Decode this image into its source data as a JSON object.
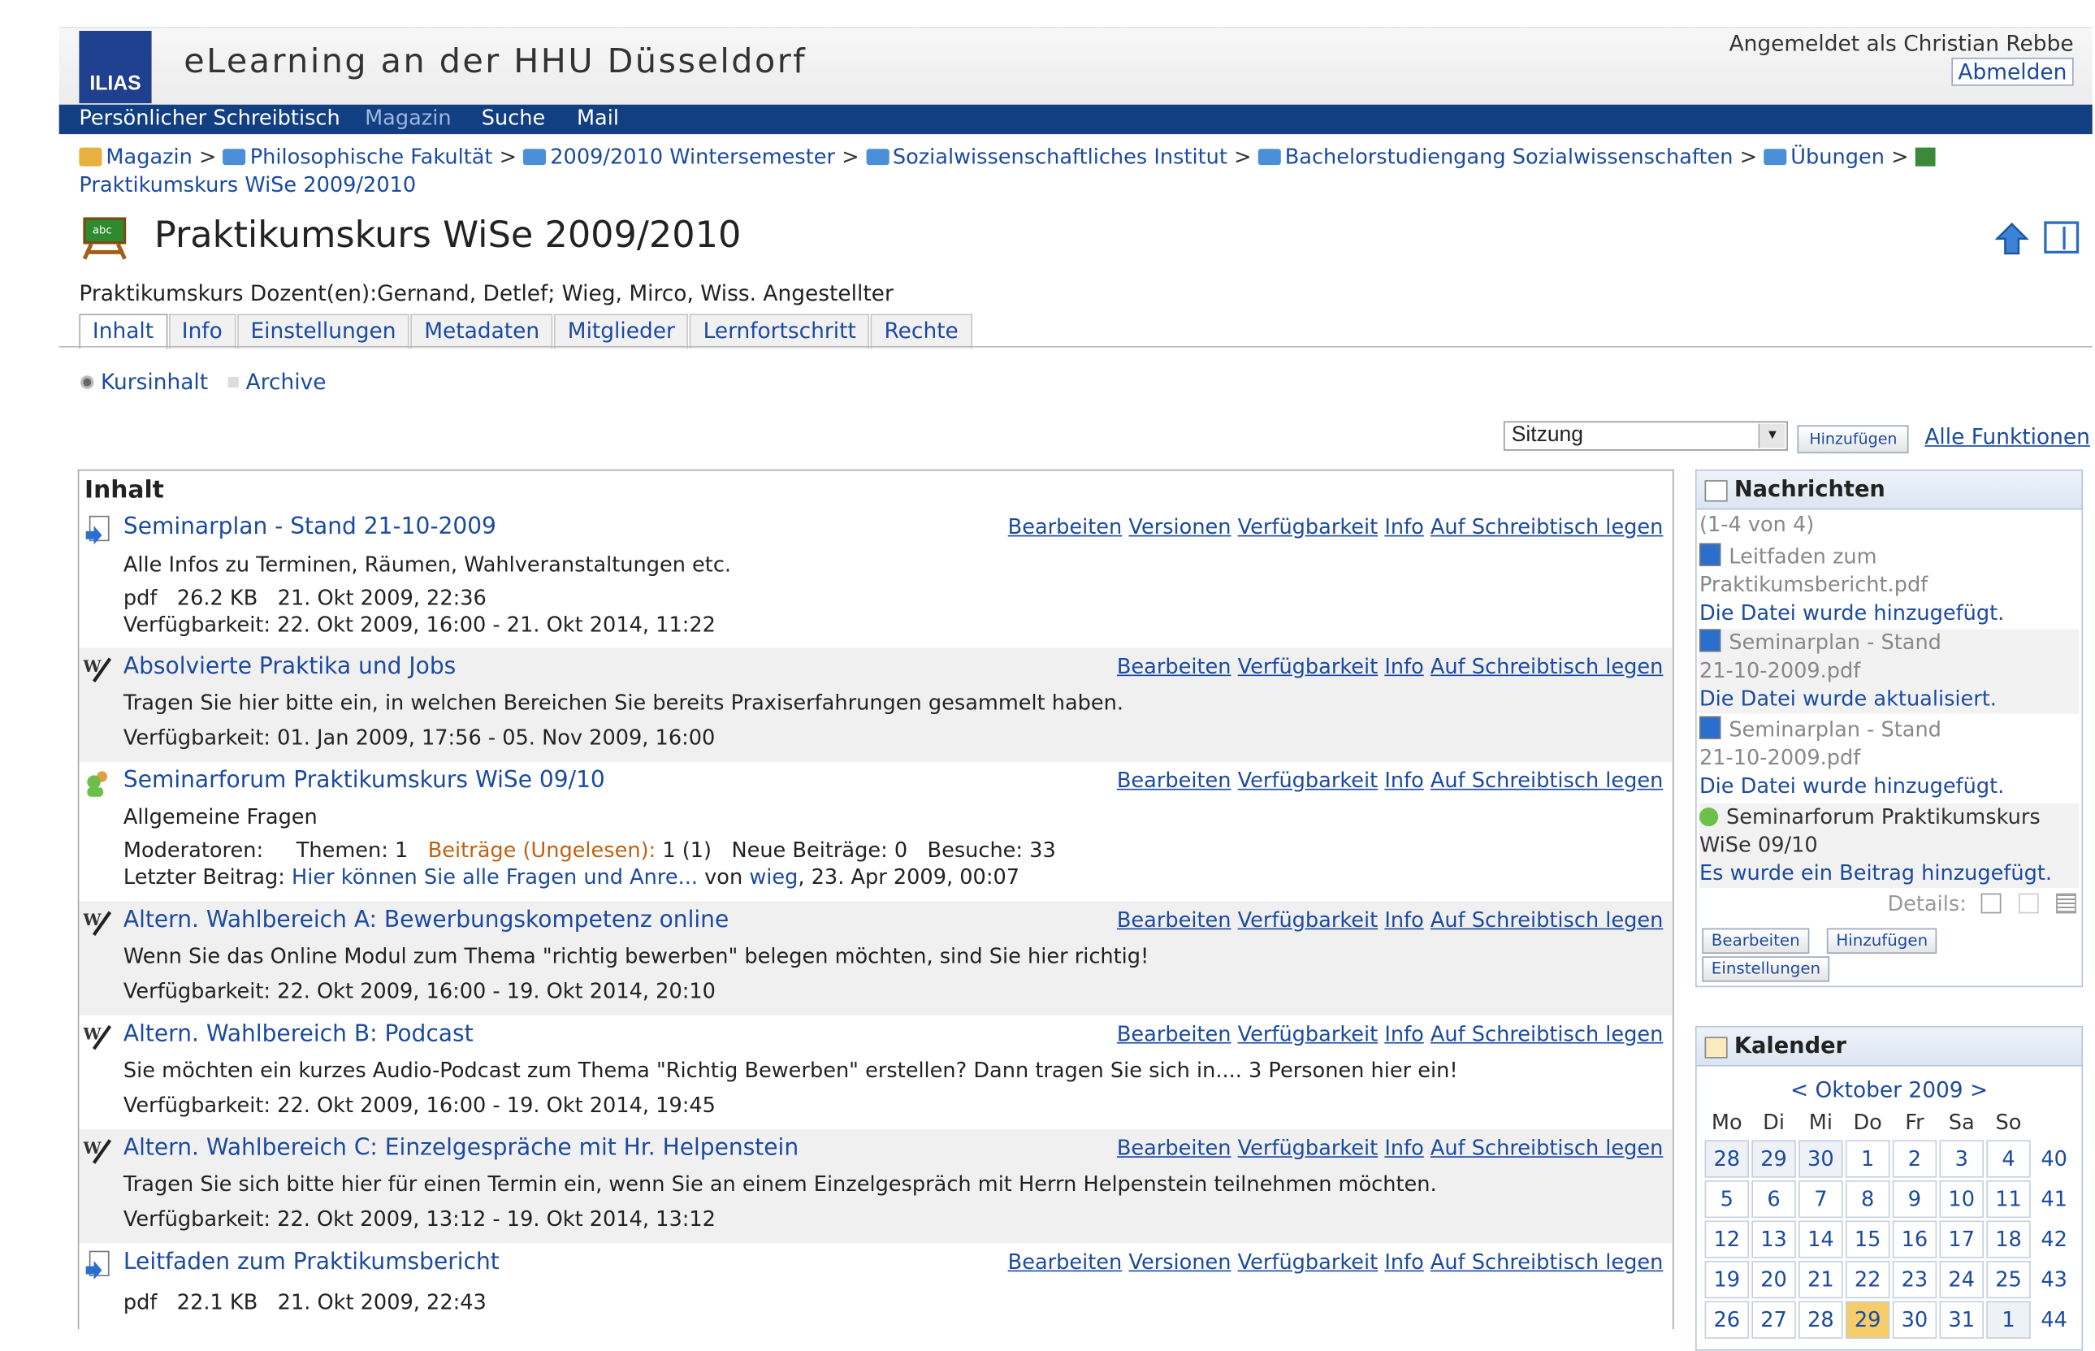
{
  "header": {
    "logo": "ILIAS",
    "site_title": "eLearning an der HHU Düsseldorf",
    "logged_in": "Angemeldet als Christian Rebbe",
    "logout": "Abmelden"
  },
  "nav": [
    "Persönlicher Schreibtisch",
    "Magazin",
    "Suche",
    "Mail"
  ],
  "breadcrumb": {
    "items": [
      "Magazin",
      "Philosophische Fakultät",
      "2009/2010 Wintersemester",
      "Sozialwissenschaftliches Institut",
      "Bachelorstudiengang Sozialwissenschaften",
      "Übungen"
    ],
    "current": "Praktikumskurs WiSe 2009/2010",
    "sep": ">"
  },
  "course": {
    "title": "Praktikumskurs WiSe 2009/2010",
    "description": "Praktikumskurs Dozent(en):Gernand, Detlef; Wieg, Mirco, Wiss. Angestellter"
  },
  "tabs": [
    "Inhalt",
    "Info",
    "Einstellungen",
    "Metadaten",
    "Mitglieder",
    "Lernfortschritt",
    "Rechte"
  ],
  "subtabs": [
    "Kursinhalt",
    "Archive"
  ],
  "toolbar": {
    "select_value": "Sitzung",
    "add": "Hinzufügen",
    "all_functions": "Alle Funktionen"
  },
  "content": {
    "heading": "Inhalt",
    "items": [
      {
        "title": "Seminarplan - Stand 21-10-2009",
        "cmds": [
          "Bearbeiten",
          "Versionen",
          "Verfügbarkeit",
          "Info",
          "Auf Schreibtisch legen"
        ],
        "desc": "Alle Infos zu Terminen, Räumen, Wahlveranstaltungen etc.",
        "props": "pdf   26.2 KB   21. Okt 2009, 22:36",
        "avail": "Verfügbarkeit: 22. Okt 2009, 16:00 - 21. Okt 2014, 11:22"
      },
      {
        "title": "Absolvierte Praktika und Jobs",
        "cmds": [
          "Bearbeiten",
          "Verfügbarkeit",
          "Info",
          "Auf Schreibtisch legen"
        ],
        "desc": "Tragen Sie hier bitte ein, in welchen Bereichen Sie bereits Praxiserfahrungen gesammelt haben.",
        "avail": "Verfügbarkeit: 01. Jan 2009, 17:56 - 05. Nov 2009, 16:00"
      },
      {
        "title": "Seminarforum Praktikumskurs WiSe 09/10",
        "cmds": [
          "Bearbeiten",
          "Verfügbarkeit",
          "Info",
          "Auf Schreibtisch legen"
        ],
        "desc": "Allgemeine Fragen",
        "moderators": "Moderatoren:",
        "topics": "Themen: 1",
        "posts_label": "Beiträge (Ungelesen):",
        "posts_value": "1 (1)",
        "new_posts": "Neue Beiträge: 0",
        "visits": "Besuche: 33",
        "last_post_label": "Letzter Beitrag:",
        "last_post_link": "Hier können Sie alle Fragen und Anre...",
        "by": "von",
        "author": "wieg",
        "last_post_date": ", 23. Apr 2009, 00:07"
      },
      {
        "title": "Altern. Wahlbereich A: Bewerbungskompetenz online",
        "cmds": [
          "Bearbeiten",
          "Verfügbarkeit",
          "Info",
          "Auf Schreibtisch legen"
        ],
        "desc": "Wenn Sie das Online Modul zum Thema \"richtig bewerben\" belegen möchten, sind Sie hier richtig!",
        "avail": "Verfügbarkeit: 22. Okt 2009, 16:00 - 19. Okt 2014, 20:10"
      },
      {
        "title": "Altern. Wahlbereich B: Podcast",
        "cmds": [
          "Bearbeiten",
          "Verfügbarkeit",
          "Info",
          "Auf Schreibtisch legen"
        ],
        "desc": "Sie möchten ein kurzes Audio-Podcast zum Thema \"Richtig Bewerben\" erstellen? Dann tragen Sie sich in.... 3 Personen hier ein!",
        "avail": "Verfügbarkeit: 22. Okt 2009, 16:00 - 19. Okt 2014, 19:45"
      },
      {
        "title": "Altern. Wahlbereich C: Einzelgespräche mit Hr. Helpenstein",
        "cmds": [
          "Bearbeiten",
          "Verfügbarkeit",
          "Info",
          "Auf Schreibtisch legen"
        ],
        "desc": "Tragen Sie sich bitte hier für einen Termin ein, wenn Sie an einem Einzelgespräch mit Herrn Helpenstein teilnehmen möchten.",
        "avail": "Verfügbarkeit: 22. Okt 2009, 13:12 - 19. Okt 2014, 13:12"
      },
      {
        "title": "Leitfaden zum Praktikumsbericht",
        "cmds": [
          "Bearbeiten",
          "Versionen",
          "Verfügbarkeit",
          "Info",
          "Auf Schreibtisch legen"
        ],
        "props": "pdf   22.1 KB   21. Okt 2009, 22:43"
      }
    ]
  },
  "news": {
    "heading": "Nachrichten",
    "count": "(1-4 von 4)",
    "items": [
      {
        "title1": "Leitfaden zum",
        "title2": "Praktikumsbericht.pdf",
        "text": "Die Datei wurde hinzugefügt."
      },
      {
        "title1": "Seminarplan - Stand",
        "title2": "21-10-2009.pdf",
        "text": "Die Datei wurde aktualisiert."
      },
      {
        "title1": "Seminarplan - Stand",
        "title2": "21-10-2009.pdf",
        "text": "Die Datei wurde hinzugefügt."
      },
      {
        "title1": "Seminarforum Praktikumskurs",
        "title2": "WiSe 09/10",
        "text": "Es wurde ein Beitrag hinzugefügt."
      }
    ],
    "details": "Details:",
    "buttons": [
      "Bearbeiten",
      "Hinzufügen",
      "Einstellungen"
    ]
  },
  "calendar": {
    "heading": "Kalender",
    "month": "< Oktober 2009 >",
    "weekdays": [
      "Mo",
      "Di",
      "Mi",
      "Do",
      "Fr",
      "Sa",
      "So"
    ],
    "weeks": [
      {
        "days": [
          "28",
          "29",
          "30",
          "1",
          "2",
          "3",
          "4"
        ],
        "kw": "40"
      },
      {
        "days": [
          "5",
          "6",
          "7",
          "8",
          "9",
          "10",
          "11"
        ],
        "kw": "41"
      },
      {
        "days": [
          "12",
          "13",
          "14",
          "15",
          "16",
          "17",
          "18"
        ],
        "kw": "42"
      },
      {
        "days": [
          "19",
          "20",
          "21",
          "22",
          "23",
          "24",
          "25"
        ],
        "kw": "43"
      },
      {
        "days": [
          "26",
          "27",
          "28",
          "29",
          "30",
          "31",
          "1"
        ],
        "kw": "44"
      }
    ],
    "today": "29"
  },
  "colors": {
    "nav_bg": "#123e82",
    "link": "#1b4aa0",
    "today": "#f5cd6a",
    "posts_label": "#c06010"
  }
}
